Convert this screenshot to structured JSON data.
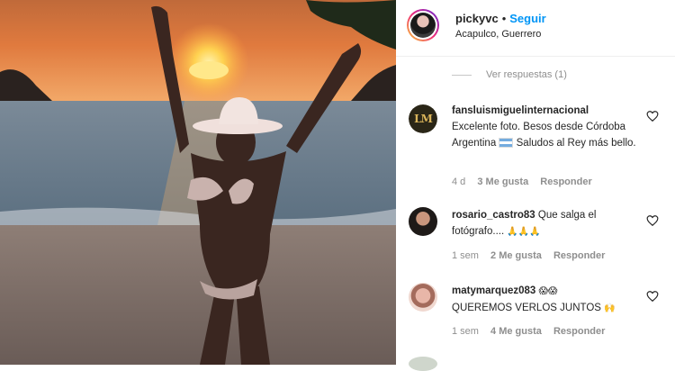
{
  "post": {
    "username": "pickyvc",
    "separator": "•",
    "follow_label": "Seguir",
    "location": "Acapulco, Guerrero"
  },
  "replies": {
    "view_label": "Ver respuestas (1)"
  },
  "comments": [
    {
      "username": "fansluismiguelinternacional",
      "avatar_text": "LM",
      "text_before_flag": "Excelente foto. Besos desde Córdoba Argentina",
      "text_after_flag": "Saludos al Rey más bello.",
      "time": "4 d",
      "likes": "3 Me gusta",
      "reply": "Responder"
    },
    {
      "username": "rosario_castro83",
      "text": "Que salga el fotógrafo....",
      "emoji": "🙏🙏🙏",
      "time": "1 sem",
      "likes": "2 Me gusta",
      "reply": "Responder"
    },
    {
      "username": "matymarquez083",
      "text": "QUEREMOS VERLOS JUNTOS",
      "emoji_before": "😱😱",
      "emoji_after": "🙌",
      "time": "1 sem",
      "likes": "4 Me gusta",
      "reply": "Responder"
    }
  ],
  "colors": {
    "follow_blue": "#0095f6",
    "meta_gray": "#8e8e8e",
    "text_dark": "#262626"
  }
}
